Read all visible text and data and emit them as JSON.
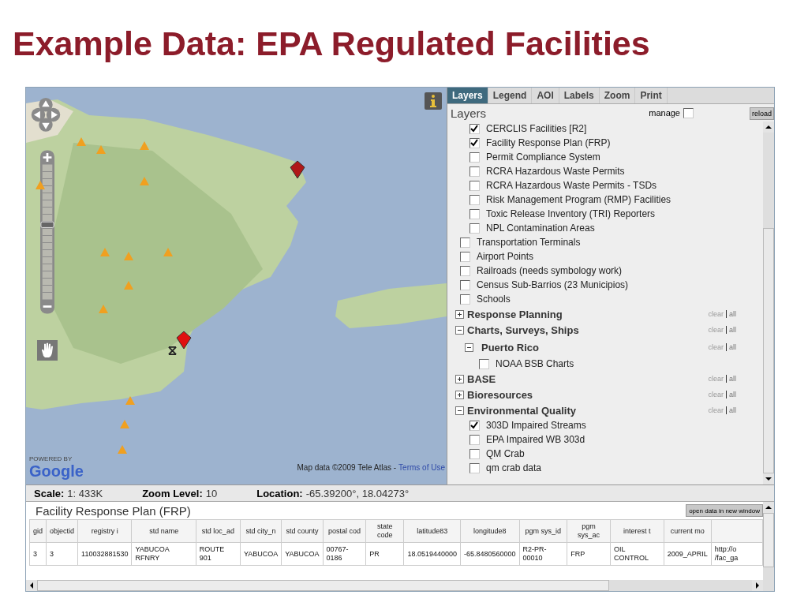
{
  "slide_title": "Example Data: EPA Regulated Facilities",
  "map": {
    "powered_by": "POWERED BY",
    "logo": "Google",
    "attribution": "Map data ©2009 Tele Atlas -",
    "terms_link": "Terms of Use",
    "zoom": {
      "level": 0.55
    }
  },
  "panel": {
    "tabs": [
      {
        "label": "Layers",
        "selected": true
      },
      {
        "label": "Legend",
        "selected": false
      },
      {
        "label": "AOI",
        "selected": false
      },
      {
        "label": "Labels",
        "selected": false
      },
      {
        "label": "Zoom",
        "selected": false
      },
      {
        "label": "Print",
        "selected": false
      }
    ],
    "heading": "Layers",
    "manage_label": "manage",
    "manage_checked": false,
    "reload_button": "reload",
    "tree": [
      {
        "kind": "set",
        "children": [
          {
            "kind": "layer",
            "label": "CERCLIS Facilities [R2]",
            "checked": true
          },
          {
            "kind": "layer",
            "label": "Facility Response Plan (FRP)",
            "checked": true
          },
          {
            "kind": "layer",
            "label": "Permit Compliance System",
            "checked": false
          },
          {
            "kind": "layer",
            "label": "RCRA Hazardous Waste Permits",
            "checked": false
          },
          {
            "kind": "layer",
            "label": "RCRA Hazardous Waste Permits - TSDs",
            "checked": false
          },
          {
            "kind": "layer",
            "label": "Risk Management Program (RMP) Facilities",
            "checked": false
          },
          {
            "kind": "layer",
            "label": "Toxic Release Inventory (TRI) Reporters",
            "checked": false
          },
          {
            "kind": "layer",
            "label": "NPL Contamination Areas",
            "checked": false
          }
        ]
      },
      {
        "kind": "layer",
        "label": "Transportation Terminals",
        "checked": false
      },
      {
        "kind": "layer",
        "label": "Airport Points",
        "checked": false
      },
      {
        "kind": "layer",
        "label": "Railroads (needs symbology work)",
        "checked": false
      },
      {
        "kind": "layer",
        "label": "Census Sub-Barrios (23 Municipios)",
        "checked": false
      },
      {
        "kind": "layer",
        "label": "Schools",
        "checked": false
      },
      {
        "kind": "group",
        "label": "Response Planning",
        "expanded": false,
        "clear": "clear",
        "all": "all"
      },
      {
        "kind": "group",
        "label": "Charts, Surveys, Ships",
        "expanded": true,
        "clear": "clear",
        "all": "all",
        "children": [
          {
            "kind": "group",
            "label": "Puerto Rico",
            "expanded": true,
            "clear": "clear",
            "all": "all",
            "children": [
              {
                "kind": "layer",
                "label": "NOAA BSB Charts",
                "checked": false
              }
            ]
          }
        ]
      },
      {
        "kind": "group",
        "label": "BASE",
        "expanded": false,
        "clear": "clear",
        "all": "all"
      },
      {
        "kind": "group",
        "label": "Bioresources",
        "expanded": false,
        "clear": "clear",
        "all": "all"
      },
      {
        "kind": "group",
        "label": "Environmental Quality",
        "expanded": true,
        "clear": "clear",
        "all": "all",
        "children": [
          {
            "kind": "layer",
            "label": "303D Impaired Streams",
            "checked": true
          },
          {
            "kind": "layer",
            "label": "EPA Impaired WB 303d",
            "checked": false
          },
          {
            "kind": "layer",
            "label": "QM Crab",
            "checked": false
          },
          {
            "kind": "layer",
            "label": "qm crab data",
            "checked": false
          }
        ]
      }
    ]
  },
  "status_bar": [
    {
      "label": "Scale:",
      "value": "1: 433K"
    },
    {
      "label": "Zoom Level:",
      "value": "10"
    },
    {
      "label": "Location:",
      "value": "-65.39200°, 18.04273°"
    }
  ],
  "data_panel": {
    "title": "Facility Response Plan (FRP)",
    "open_button": "open data in new window",
    "columns": [
      "gid",
      "objectid",
      "registry i",
      "std name",
      "std loc_ad",
      "std city_n",
      "std county",
      "postal cod",
      "state code",
      "latitude83",
      "longitude8",
      "pgm sys_id",
      "pgm sys_ac",
      "interest t",
      "current mo"
    ],
    "rows": [
      [
        "3",
        "3",
        "110032881530",
        "YABUCOA RFNRY",
        "ROUTE 901",
        "YABUCOA",
        "YABUCOA",
        "00767-0186",
        "PR",
        "18.0519440000",
        "-65.8480560000",
        "R2-PR-00010",
        "FRP",
        "OIL CONTROL",
        "2009_APRIL",
        "http://o /fac_ga"
      ]
    ]
  }
}
